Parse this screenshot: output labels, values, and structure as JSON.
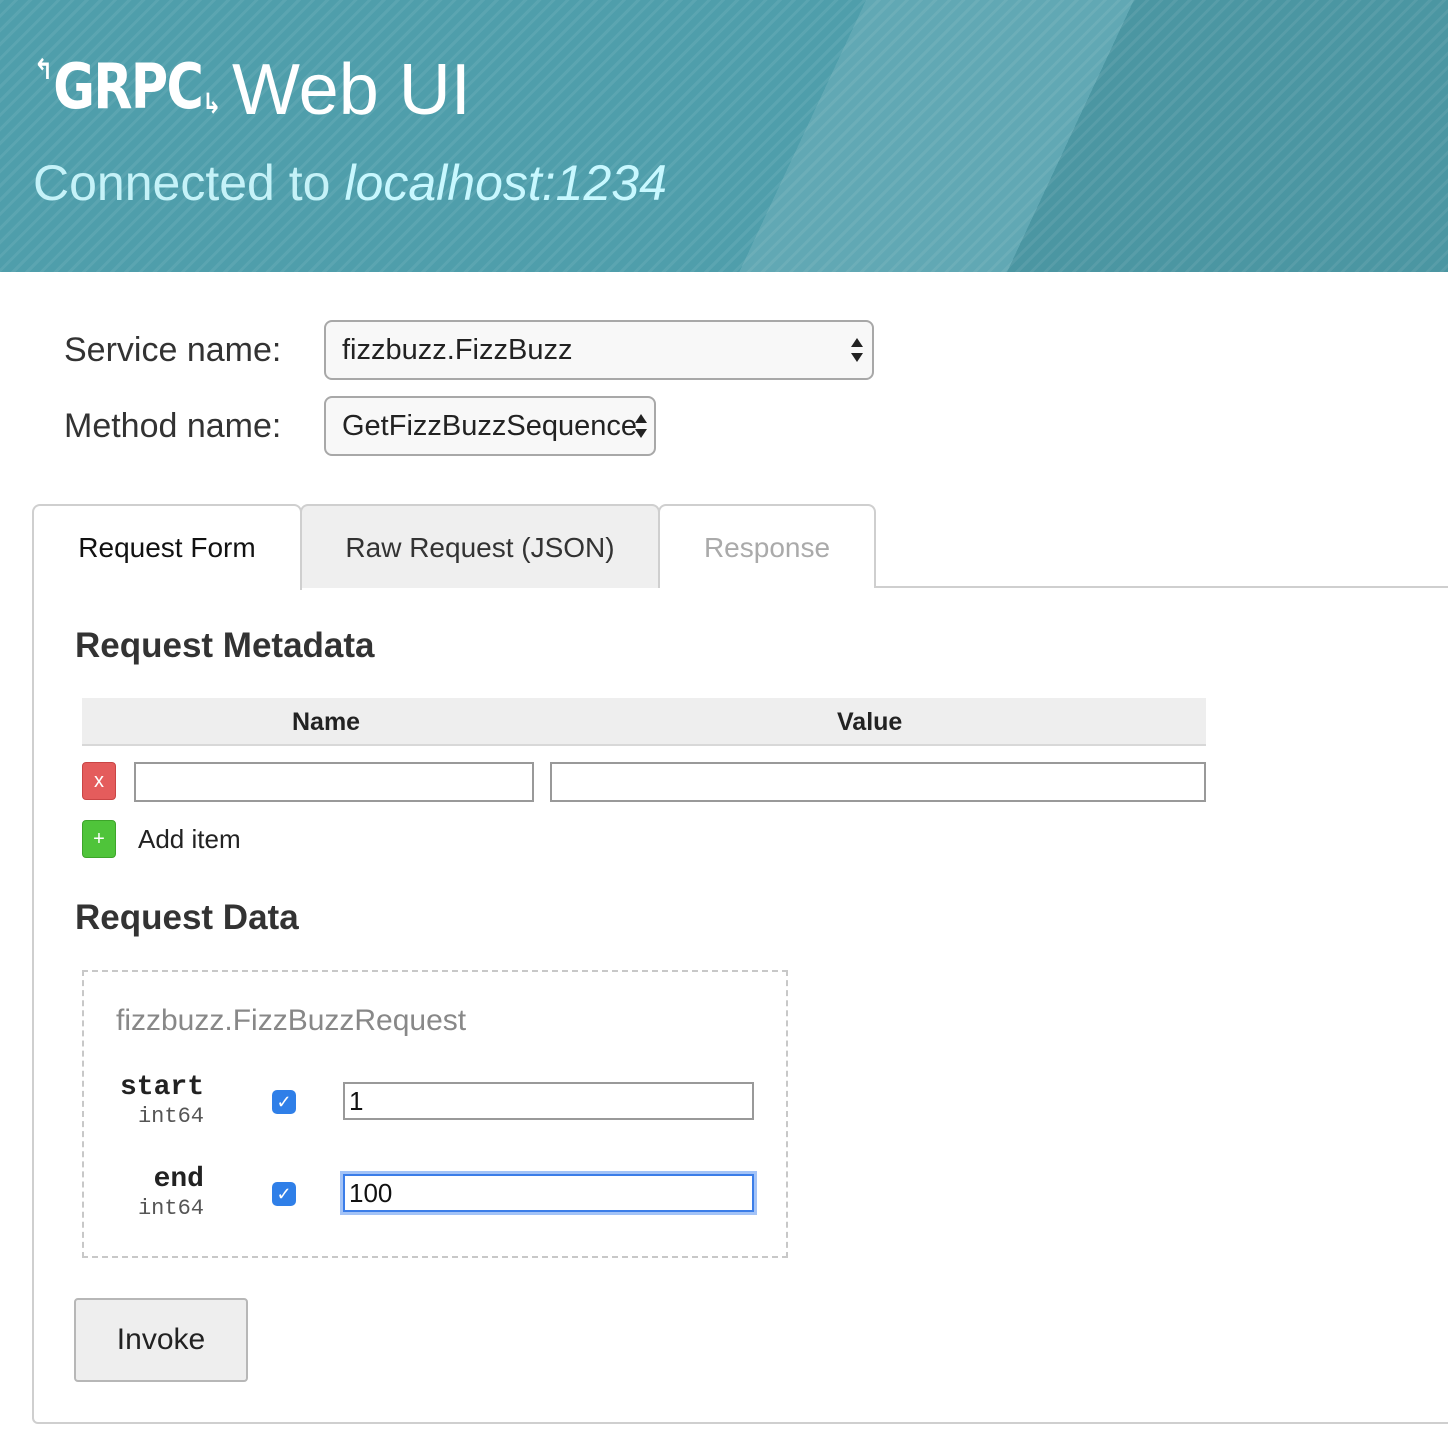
{
  "header": {
    "logo": "GRPC",
    "title": "Web UI",
    "connected_label": "Connected to",
    "host": "localhost:1234"
  },
  "service": {
    "label": "Service name:",
    "value": "fizzbuzz.FizzBuzz"
  },
  "method": {
    "label": "Method name:",
    "value": "GetFizzBuzzSequence"
  },
  "tabs": [
    {
      "label": "Request Form",
      "state": "active"
    },
    {
      "label": "Raw Request (JSON)",
      "state": "inactive"
    },
    {
      "label": "Response",
      "state": "disabled"
    }
  ],
  "metadata": {
    "heading": "Request Metadata",
    "columns": [
      "Name",
      "Value"
    ],
    "remove_label": "x",
    "add_symbol": "+",
    "add_label": "Add item",
    "rows": [
      {
        "name": "",
        "value": ""
      }
    ]
  },
  "request_data": {
    "heading": "Request Data",
    "message_type": "fizzbuzz.FizzBuzzRequest",
    "fields": [
      {
        "name": "start",
        "type": "int64",
        "checked": true,
        "value": "1"
      },
      {
        "name": "end",
        "type": "int64",
        "checked": true,
        "value": "100"
      }
    ]
  },
  "invoke_label": "Invoke",
  "colors": {
    "header_bg": "#4f9eab",
    "host_text": "#c8f8ff",
    "remove_button": "#e45c5c",
    "add_button": "#4fc43a",
    "checkbox": "#2f7fe8"
  }
}
